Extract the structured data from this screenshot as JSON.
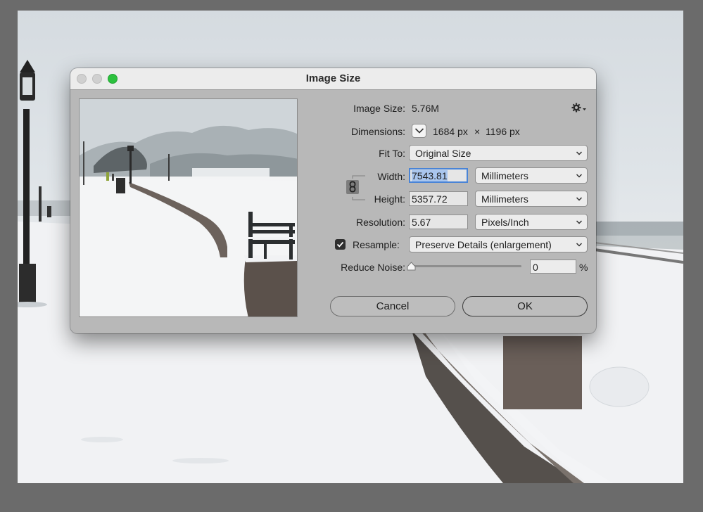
{
  "dialog": {
    "title": "Image Size",
    "gear_icon": "gear-icon"
  },
  "info": {
    "image_size_label": "Image Size:",
    "image_size_value": "5.76M",
    "dimensions_label": "Dimensions:",
    "dimensions_width": "1684 px",
    "dimensions_times": "×",
    "dimensions_height": "1196 px"
  },
  "fit_to": {
    "label": "Fit To:",
    "value": "Original Size"
  },
  "width": {
    "label": "Width:",
    "value": "7543.81",
    "unit": "Millimeters"
  },
  "height": {
    "label": "Height:",
    "value": "5357.72",
    "unit": "Millimeters"
  },
  "resolution": {
    "label": "Resolution:",
    "value": "5.67",
    "unit": "Pixels/Inch"
  },
  "resample": {
    "label": "Resample:",
    "checked": true,
    "method": "Preserve Details (enlargement)"
  },
  "reduce_noise": {
    "label": "Reduce Noise:",
    "value": "0",
    "unit": "%",
    "level": 0
  },
  "buttons": {
    "cancel": "Cancel",
    "ok": "OK"
  },
  "colors": {
    "zoom_button": "#2cc13e",
    "focus_ring": "#4a84d6",
    "dialog_bg": "#b8b8b8"
  }
}
